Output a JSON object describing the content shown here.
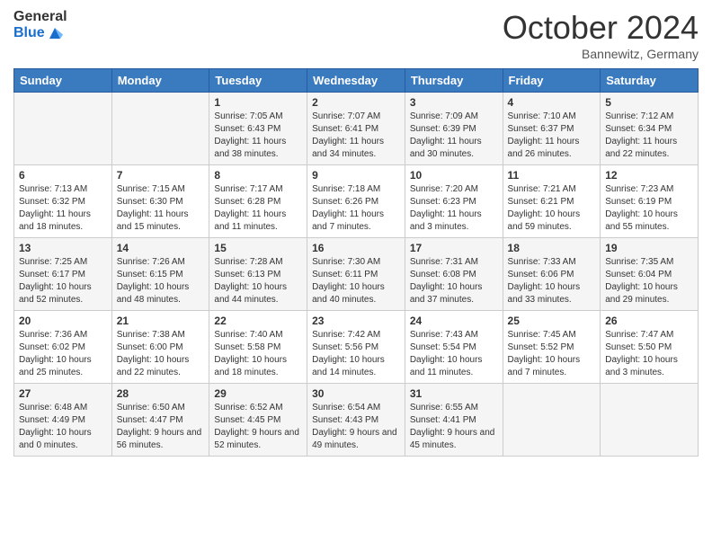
{
  "header": {
    "logo_general": "General",
    "logo_blue": "Blue",
    "month": "October 2024",
    "location": "Bannewitz, Germany"
  },
  "days_of_week": [
    "Sunday",
    "Monday",
    "Tuesday",
    "Wednesday",
    "Thursday",
    "Friday",
    "Saturday"
  ],
  "weeks": [
    [
      {
        "day": "",
        "info": ""
      },
      {
        "day": "",
        "info": ""
      },
      {
        "day": "1",
        "info": "Sunrise: 7:05 AM\nSunset: 6:43 PM\nDaylight: 11 hours and 38 minutes."
      },
      {
        "day": "2",
        "info": "Sunrise: 7:07 AM\nSunset: 6:41 PM\nDaylight: 11 hours and 34 minutes."
      },
      {
        "day": "3",
        "info": "Sunrise: 7:09 AM\nSunset: 6:39 PM\nDaylight: 11 hours and 30 minutes."
      },
      {
        "day": "4",
        "info": "Sunrise: 7:10 AM\nSunset: 6:37 PM\nDaylight: 11 hours and 26 minutes."
      },
      {
        "day": "5",
        "info": "Sunrise: 7:12 AM\nSunset: 6:34 PM\nDaylight: 11 hours and 22 minutes."
      }
    ],
    [
      {
        "day": "6",
        "info": "Sunrise: 7:13 AM\nSunset: 6:32 PM\nDaylight: 11 hours and 18 minutes."
      },
      {
        "day": "7",
        "info": "Sunrise: 7:15 AM\nSunset: 6:30 PM\nDaylight: 11 hours and 15 minutes."
      },
      {
        "day": "8",
        "info": "Sunrise: 7:17 AM\nSunset: 6:28 PM\nDaylight: 11 hours and 11 minutes."
      },
      {
        "day": "9",
        "info": "Sunrise: 7:18 AM\nSunset: 6:26 PM\nDaylight: 11 hours and 7 minutes."
      },
      {
        "day": "10",
        "info": "Sunrise: 7:20 AM\nSunset: 6:23 PM\nDaylight: 11 hours and 3 minutes."
      },
      {
        "day": "11",
        "info": "Sunrise: 7:21 AM\nSunset: 6:21 PM\nDaylight: 10 hours and 59 minutes."
      },
      {
        "day": "12",
        "info": "Sunrise: 7:23 AM\nSunset: 6:19 PM\nDaylight: 10 hours and 55 minutes."
      }
    ],
    [
      {
        "day": "13",
        "info": "Sunrise: 7:25 AM\nSunset: 6:17 PM\nDaylight: 10 hours and 52 minutes."
      },
      {
        "day": "14",
        "info": "Sunrise: 7:26 AM\nSunset: 6:15 PM\nDaylight: 10 hours and 48 minutes."
      },
      {
        "day": "15",
        "info": "Sunrise: 7:28 AM\nSunset: 6:13 PM\nDaylight: 10 hours and 44 minutes."
      },
      {
        "day": "16",
        "info": "Sunrise: 7:30 AM\nSunset: 6:11 PM\nDaylight: 10 hours and 40 minutes."
      },
      {
        "day": "17",
        "info": "Sunrise: 7:31 AM\nSunset: 6:08 PM\nDaylight: 10 hours and 37 minutes."
      },
      {
        "day": "18",
        "info": "Sunrise: 7:33 AM\nSunset: 6:06 PM\nDaylight: 10 hours and 33 minutes."
      },
      {
        "day": "19",
        "info": "Sunrise: 7:35 AM\nSunset: 6:04 PM\nDaylight: 10 hours and 29 minutes."
      }
    ],
    [
      {
        "day": "20",
        "info": "Sunrise: 7:36 AM\nSunset: 6:02 PM\nDaylight: 10 hours and 25 minutes."
      },
      {
        "day": "21",
        "info": "Sunrise: 7:38 AM\nSunset: 6:00 PM\nDaylight: 10 hours and 22 minutes."
      },
      {
        "day": "22",
        "info": "Sunrise: 7:40 AM\nSunset: 5:58 PM\nDaylight: 10 hours and 18 minutes."
      },
      {
        "day": "23",
        "info": "Sunrise: 7:42 AM\nSunset: 5:56 PM\nDaylight: 10 hours and 14 minutes."
      },
      {
        "day": "24",
        "info": "Sunrise: 7:43 AM\nSunset: 5:54 PM\nDaylight: 10 hours and 11 minutes."
      },
      {
        "day": "25",
        "info": "Sunrise: 7:45 AM\nSunset: 5:52 PM\nDaylight: 10 hours and 7 minutes."
      },
      {
        "day": "26",
        "info": "Sunrise: 7:47 AM\nSunset: 5:50 PM\nDaylight: 10 hours and 3 minutes."
      }
    ],
    [
      {
        "day": "27",
        "info": "Sunrise: 6:48 AM\nSunset: 4:49 PM\nDaylight: 10 hours and 0 minutes."
      },
      {
        "day": "28",
        "info": "Sunrise: 6:50 AM\nSunset: 4:47 PM\nDaylight: 9 hours and 56 minutes."
      },
      {
        "day": "29",
        "info": "Sunrise: 6:52 AM\nSunset: 4:45 PM\nDaylight: 9 hours and 52 minutes."
      },
      {
        "day": "30",
        "info": "Sunrise: 6:54 AM\nSunset: 4:43 PM\nDaylight: 9 hours and 49 minutes."
      },
      {
        "day": "31",
        "info": "Sunrise: 6:55 AM\nSunset: 4:41 PM\nDaylight: 9 hours and 45 minutes."
      },
      {
        "day": "",
        "info": ""
      },
      {
        "day": "",
        "info": ""
      }
    ]
  ]
}
